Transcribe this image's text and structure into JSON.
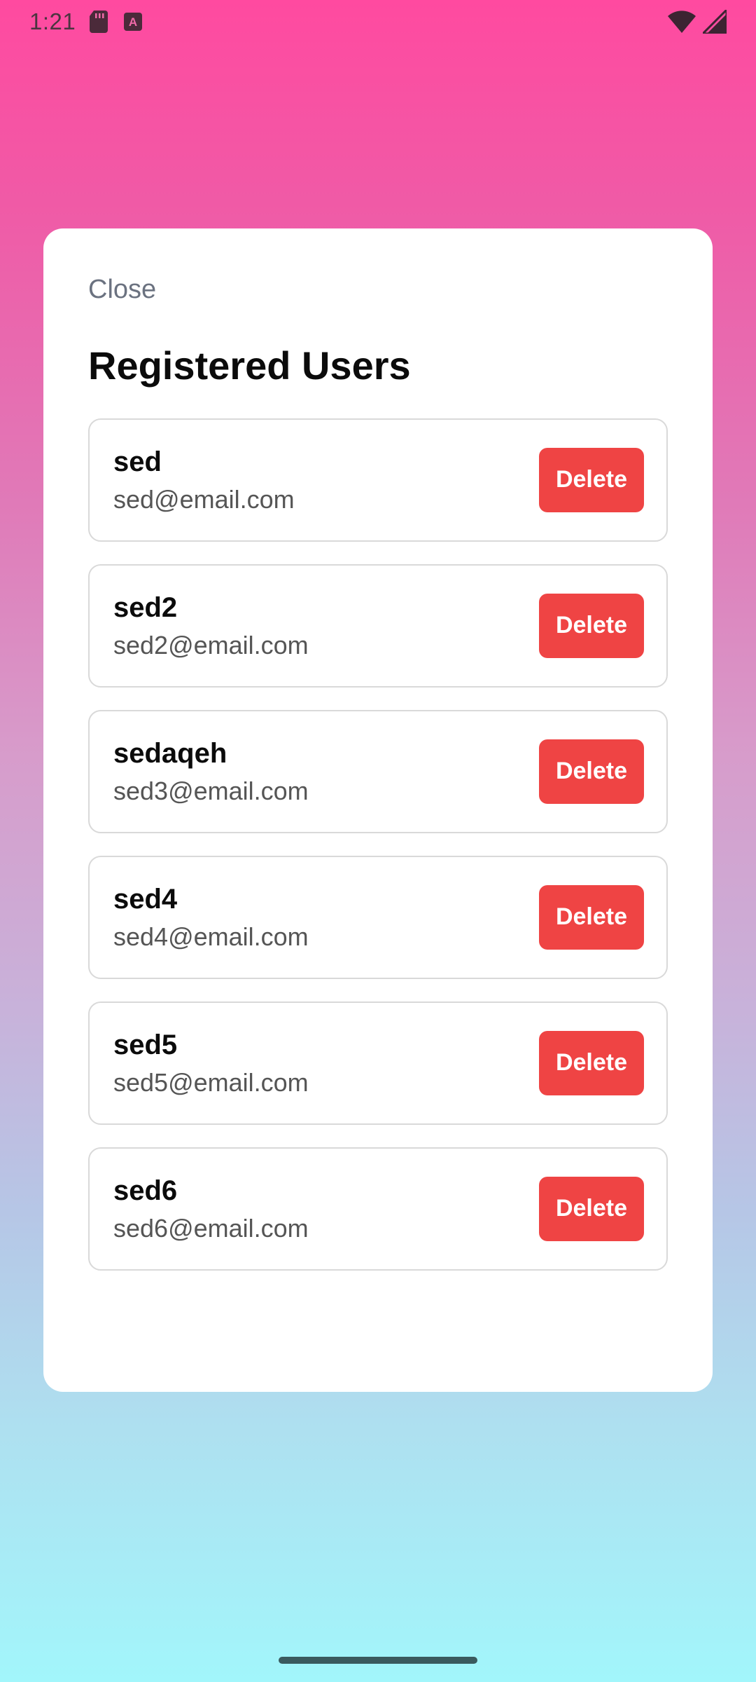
{
  "status_bar": {
    "time": "1:21",
    "left_icons": [
      "sd-card-icon",
      "keyboard-a-icon"
    ],
    "right_icons": [
      "wifi-icon",
      "cellular-signal-icon"
    ]
  },
  "modal": {
    "close_label": "Close",
    "title": "Registered Users",
    "delete_label": "Delete",
    "users": [
      {
        "name": "sed",
        "email": "sed@email.com"
      },
      {
        "name": "sed2",
        "email": "sed2@email.com"
      },
      {
        "name": "sedaqeh",
        "email": "sed3@email.com"
      },
      {
        "name": "sed4",
        "email": "sed4@email.com"
      },
      {
        "name": "sed5",
        "email": "sed5@email.com"
      },
      {
        "name": "sed6",
        "email": "sed6@email.com"
      }
    ]
  },
  "colors": {
    "delete_button": "#ef4444",
    "background_top": "#ff4aa0",
    "background_bottom": "#a2f6fb"
  }
}
